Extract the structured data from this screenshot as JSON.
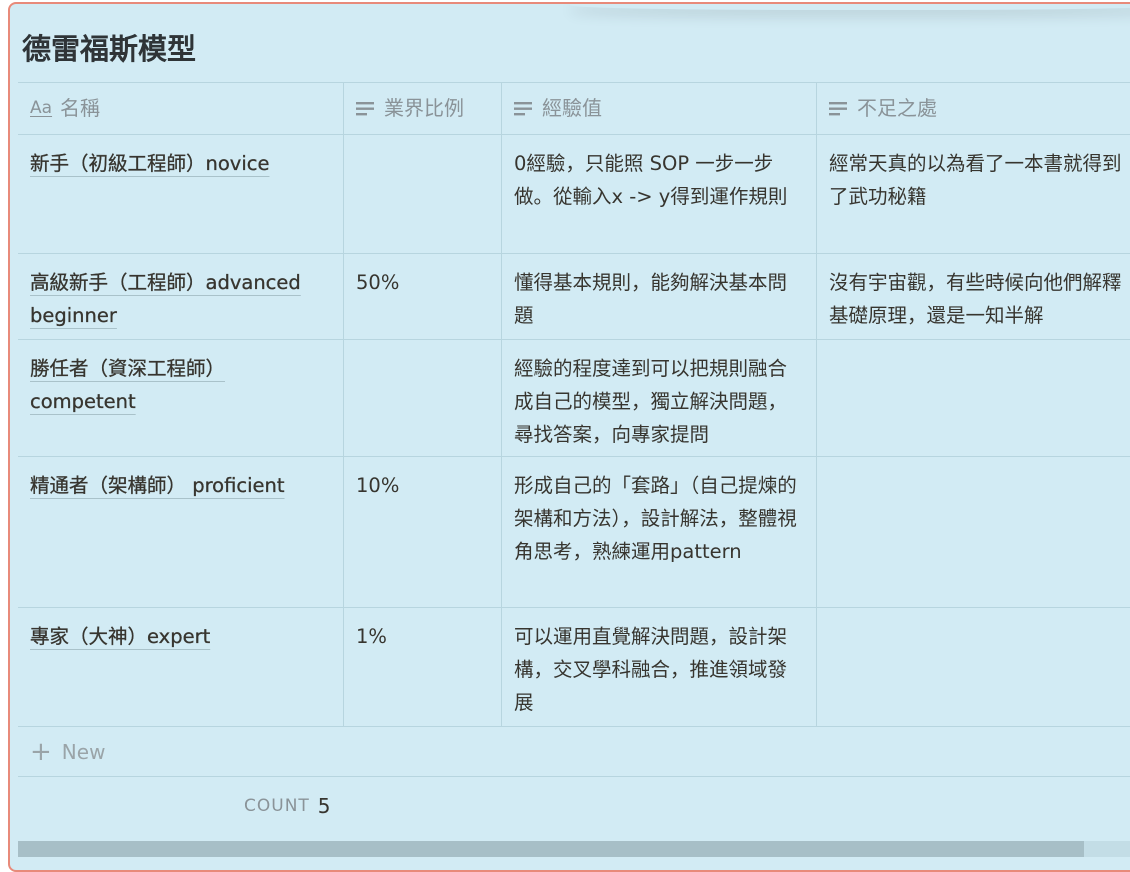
{
  "page": {
    "title": "德雷福斯模型"
  },
  "columns": [
    {
      "label": "名稱",
      "icon": "title-aa-icon"
    },
    {
      "label": "業界比例",
      "icon": "text-lines-icon"
    },
    {
      "label": "經驗值",
      "icon": "text-lines-icon"
    },
    {
      "label": "不足之處",
      "icon": "text-lines-icon"
    }
  ],
  "rows": [
    {
      "name": "新手（初級工程師）novice",
      "ratio": "",
      "experience": "0經驗，只能照 SOP 一步一步做。從輸入x -> y得到運作規則",
      "weakness": "經常天真的以為看了一本書就得到了武功秘籍"
    },
    {
      "name": "高級新手（工程師）advanced beginner",
      "ratio": "50%",
      "experience": "懂得基本規則，能夠解決基本問題",
      "weakness": "沒有宇宙觀，有些時候向他們解釋基礎原理，還是一知半解"
    },
    {
      "name": "勝任者（資深工程師） competent",
      "ratio": "",
      "experience": "經驗的程度達到可以把規則融合成自己的模型，獨立解決問題，尋找答案，向專家提問",
      "weakness": ""
    },
    {
      "name": "精通者（架構師） proficient",
      "ratio": "10%",
      "experience": "形成自己的「套路」（自己提煉的架構和方法），設計解法，整體視角思考，熟練運用pattern",
      "weakness": ""
    },
    {
      "name": "專家（大神）expert",
      "ratio": "1%",
      "experience": "可以運用直覺解決問題，設計架構，交叉學科融合，推進領域發展",
      "weakness": ""
    }
  ],
  "new_row": {
    "label": "New",
    "icon": "plus-icon"
  },
  "footer": {
    "count_label": "COUNT",
    "count_value": "5"
  },
  "colors": {
    "background": "#d2ebf4",
    "border": "#e88a7a",
    "text": "#37352f",
    "muted": "#8a9398"
  }
}
